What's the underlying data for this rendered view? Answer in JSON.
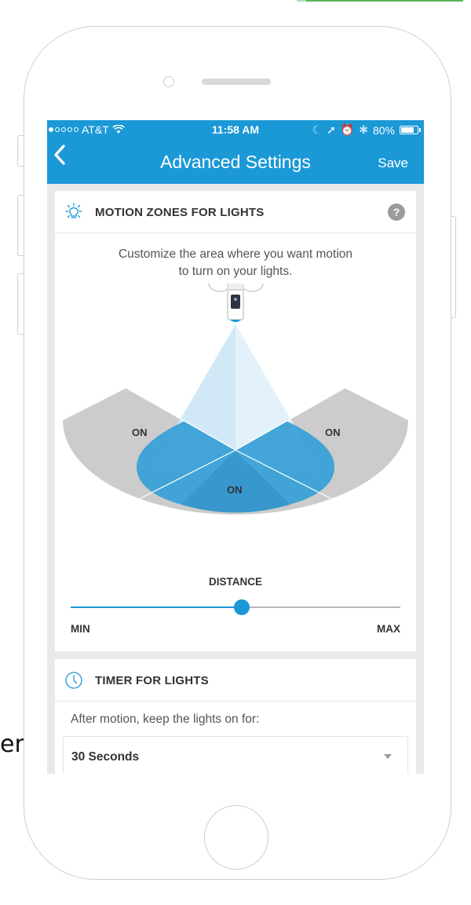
{
  "background_text": "en",
  "status_bar": {
    "carrier": "AT&T",
    "time": "11:58 AM",
    "battery": "80%",
    "battery_level": 0.8
  },
  "nav": {
    "back_icon": "chevron-left-icon",
    "title": "Advanced Settings",
    "save_label": "Save"
  },
  "motion_zones": {
    "icon": "light-bulb-icon",
    "title": "MOTION ZONES FOR LIGHTS",
    "help_label": "?",
    "description_line1": "Customize the area where you want motion",
    "description_line2": "to turn on your lights.",
    "zones": {
      "left": "ON",
      "right": "ON",
      "center": "ON"
    },
    "distance": {
      "label": "DISTANCE",
      "min_label": "MIN",
      "max_label": "MAX",
      "value": 0.52
    }
  },
  "timer": {
    "icon": "clock-icon",
    "title": "TIMER FOR LIGHTS",
    "description": "After motion, keep the lights on for:",
    "selected": "30 Seconds"
  },
  "colors": {
    "accent": "#1b98d6",
    "zone_on": "#3aa0d6",
    "zone_off": "#cccccc",
    "beam": "#cfe8f6"
  }
}
